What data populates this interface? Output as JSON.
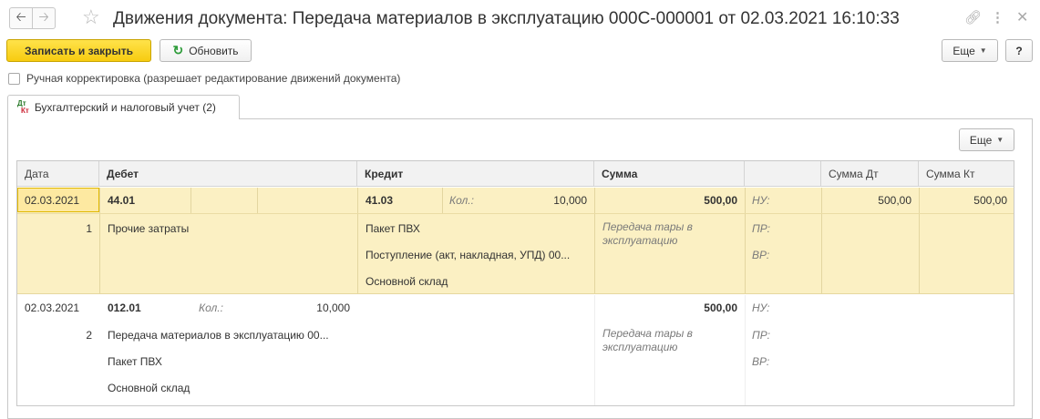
{
  "window": {
    "title": "Движения документа: Передача материалов в эксплуатацию 000С-000001 от 02.03.2021 16:10:33"
  },
  "toolbar": {
    "save_close_label": "Записать и закрыть",
    "refresh_label": "Обновить",
    "more_label": "Еще",
    "help_label": "?"
  },
  "manual_correction": {
    "label": "Ручная корректировка (разрешает редактирование движений документа)",
    "checked": false
  },
  "tab": {
    "label": "Бухгалтерский и налоговый учет (2)",
    "icon_top": "Дт",
    "icon_bottom": "Кт"
  },
  "panel": {
    "more_label": "Еще"
  },
  "table": {
    "columns": [
      "Дата",
      "Дебет",
      "Кредит",
      "Сумма",
      "",
      "Сумма Дт",
      "Сумма Кт"
    ],
    "rows": [
      {
        "date": "02.03.2021",
        "num": "1",
        "debit_account": "44.01",
        "debit_lines": [
          "Прочие затраты"
        ],
        "credit_account": "41.03",
        "credit_qty_label": "Кол.:",
        "credit_qty": "10,000",
        "credit_lines": [
          "Пакет ПВХ",
          "Поступление (акт, накладная, УПД) 00...",
          "Основной склад"
        ],
        "sum": "500,00",
        "content": "Передача тары в эксплуатацию",
        "nu_label": "НУ:",
        "pr_label": "ПР:",
        "vr_label": "ВР:",
        "sum_dt": "500,00",
        "sum_kt": "500,00"
      },
      {
        "date": "02.03.2021",
        "num": "2",
        "debit_account": "012.01",
        "debit_qty_label": "Кол.:",
        "debit_qty": "10,000",
        "debit_lines": [
          "Передача материалов в эксплуатацию 00...",
          "Пакет ПВХ",
          "Основной склад"
        ],
        "sum": "500,00",
        "content": "Передача тары в эксплуатацию",
        "nu_label": "НУ:",
        "pr_label": "ПР:",
        "vr_label": "ВР:"
      }
    ]
  }
}
